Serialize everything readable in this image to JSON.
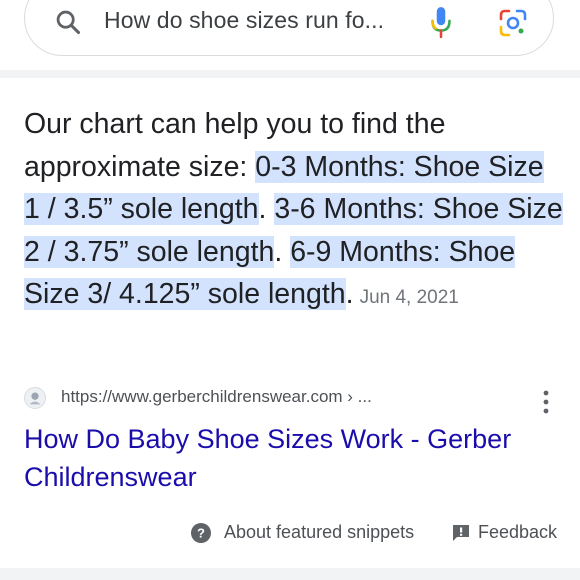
{
  "search": {
    "query": "How do shoe sizes run fo...",
    "search_icon": "search-icon",
    "mic_icon": "microphone-icon",
    "lens_icon": "google-lens-icon"
  },
  "snippet": {
    "intro": "Our chart can help you to find the approximate size: ",
    "highlights": [
      "0-3 Months: Shoe Size 1 / 3.5” sole length",
      "3-6 Months: Shoe Size 2 / 3.75” sole length",
      "6-9 Months: Shoe Size 3/ 4.125” sole length"
    ],
    "separator": ". ",
    "end": ".",
    "date": "Jun 4, 2021"
  },
  "source": {
    "url": "https://www.gerberchildrenswear.com › ...",
    "favicon_icon": "site-favicon-icon",
    "more_icon": "more-vert-icon"
  },
  "result": {
    "title": "How Do Baby Shoe Sizes Work - Gerber Childrenswear"
  },
  "footer": {
    "about_label": "About featured snippets",
    "feedback_label": "Feedback",
    "help_icon": "help-icon",
    "feedback_icon": "feedback-icon"
  },
  "colors": {
    "link": "#1a0dab",
    "highlight": "#d3e3fd",
    "text": "#202124",
    "muted": "#70757a",
    "band": "#f1f3f4"
  }
}
